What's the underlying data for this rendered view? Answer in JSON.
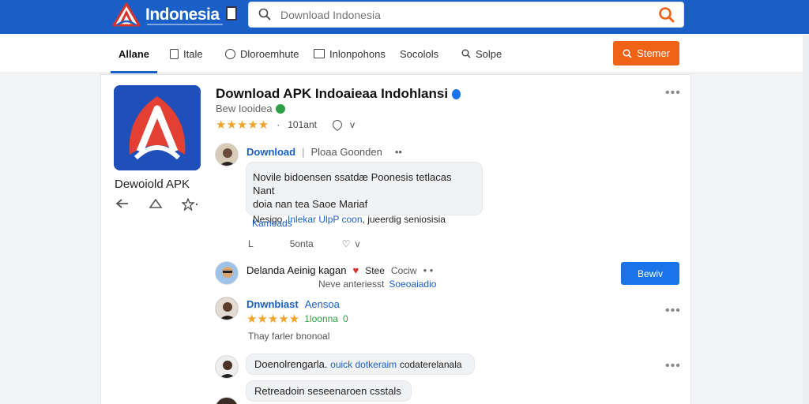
{
  "header": {
    "site_name": "Indonesia",
    "search_placeholder": "Download Indonesia"
  },
  "nav": {
    "items": [
      {
        "label": "Allane"
      },
      {
        "label": "Itale"
      },
      {
        "label": "Dloroemhute"
      },
      {
        "label": "Inlonpohons"
      },
      {
        "label": "Socolols"
      },
      {
        "label": "Solpe"
      }
    ],
    "action_label": "Stemer"
  },
  "app": {
    "title": "Download APK Indoaieaa Indohlansi",
    "subtitle": "Bew Iooidea",
    "rating_count": "101ant",
    "reactions": "v",
    "caption": "Dewoiold APK"
  },
  "comments": [
    {
      "author": "Download",
      "tag": "Ploaa Goonden",
      "body_line1": "Novile bidoensen ssatdæ Poonesis tetlacas Nant",
      "body_line2": "doia nan tea Saoe Mariaf",
      "body_line3_prefix": "Nesigo.",
      "body_link": "Inlekar UlpP coon",
      "body_line3_suffix": ", jueerdig seniosisia",
      "link_below": "Kamoads",
      "meta_reply": "L",
      "meta_count": "5onta",
      "meta_like": "v"
    },
    {
      "author": "Delanda Aeinig kagan",
      "tag": "Stee",
      "tag2": "Cociw",
      "sub_prefix": "Neve anteriesst",
      "sub_link": "Soeoaiadio",
      "button": "Bewiv"
    },
    {
      "author": "Dnwnbiast",
      "author2": "Aensoa",
      "rating_text": "1loonna",
      "rating_extra": "0",
      "body": "Thay farler bnonoal"
    },
    {
      "author": "Doenolrengarla.",
      "link": "ouick dotkeraim",
      "suffix": "codaterelanala",
      "bubble": "Retreadoin seseenaroen csstals"
    }
  ],
  "colors": {
    "brand": "#1a5fc8",
    "orange": "#f06317",
    "star": "#f0a32b"
  }
}
